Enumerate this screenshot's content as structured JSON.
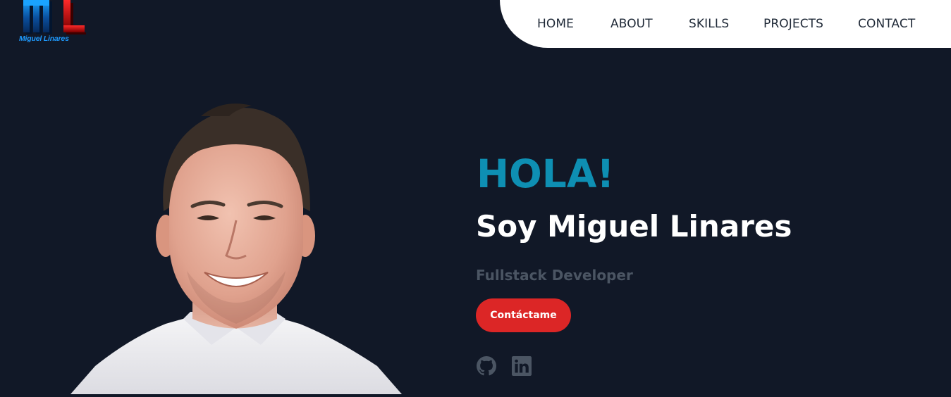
{
  "logo": {
    "caption": "Miguel Linares",
    "icon": "ml-monogram-logo"
  },
  "nav": {
    "items": [
      {
        "label": "HOME"
      },
      {
        "label": "ABOUT"
      },
      {
        "label": "SKILLS"
      },
      {
        "label": "PROJECTS"
      },
      {
        "label": "CONTACT"
      }
    ]
  },
  "hero": {
    "greeting": "HOLA!",
    "name": "Soy Miguel Linares",
    "role": "Fullstack Developer",
    "cta_label": "Contáctame",
    "portrait": "profile-photo"
  },
  "social": {
    "icons": [
      "github-icon",
      "linkedin-icon"
    ]
  },
  "colors": {
    "background": "#111827",
    "accent": "#0e8fb3",
    "button": "#dc2626",
    "muted": "#4b5563",
    "nav_bg": "#ffffff"
  }
}
